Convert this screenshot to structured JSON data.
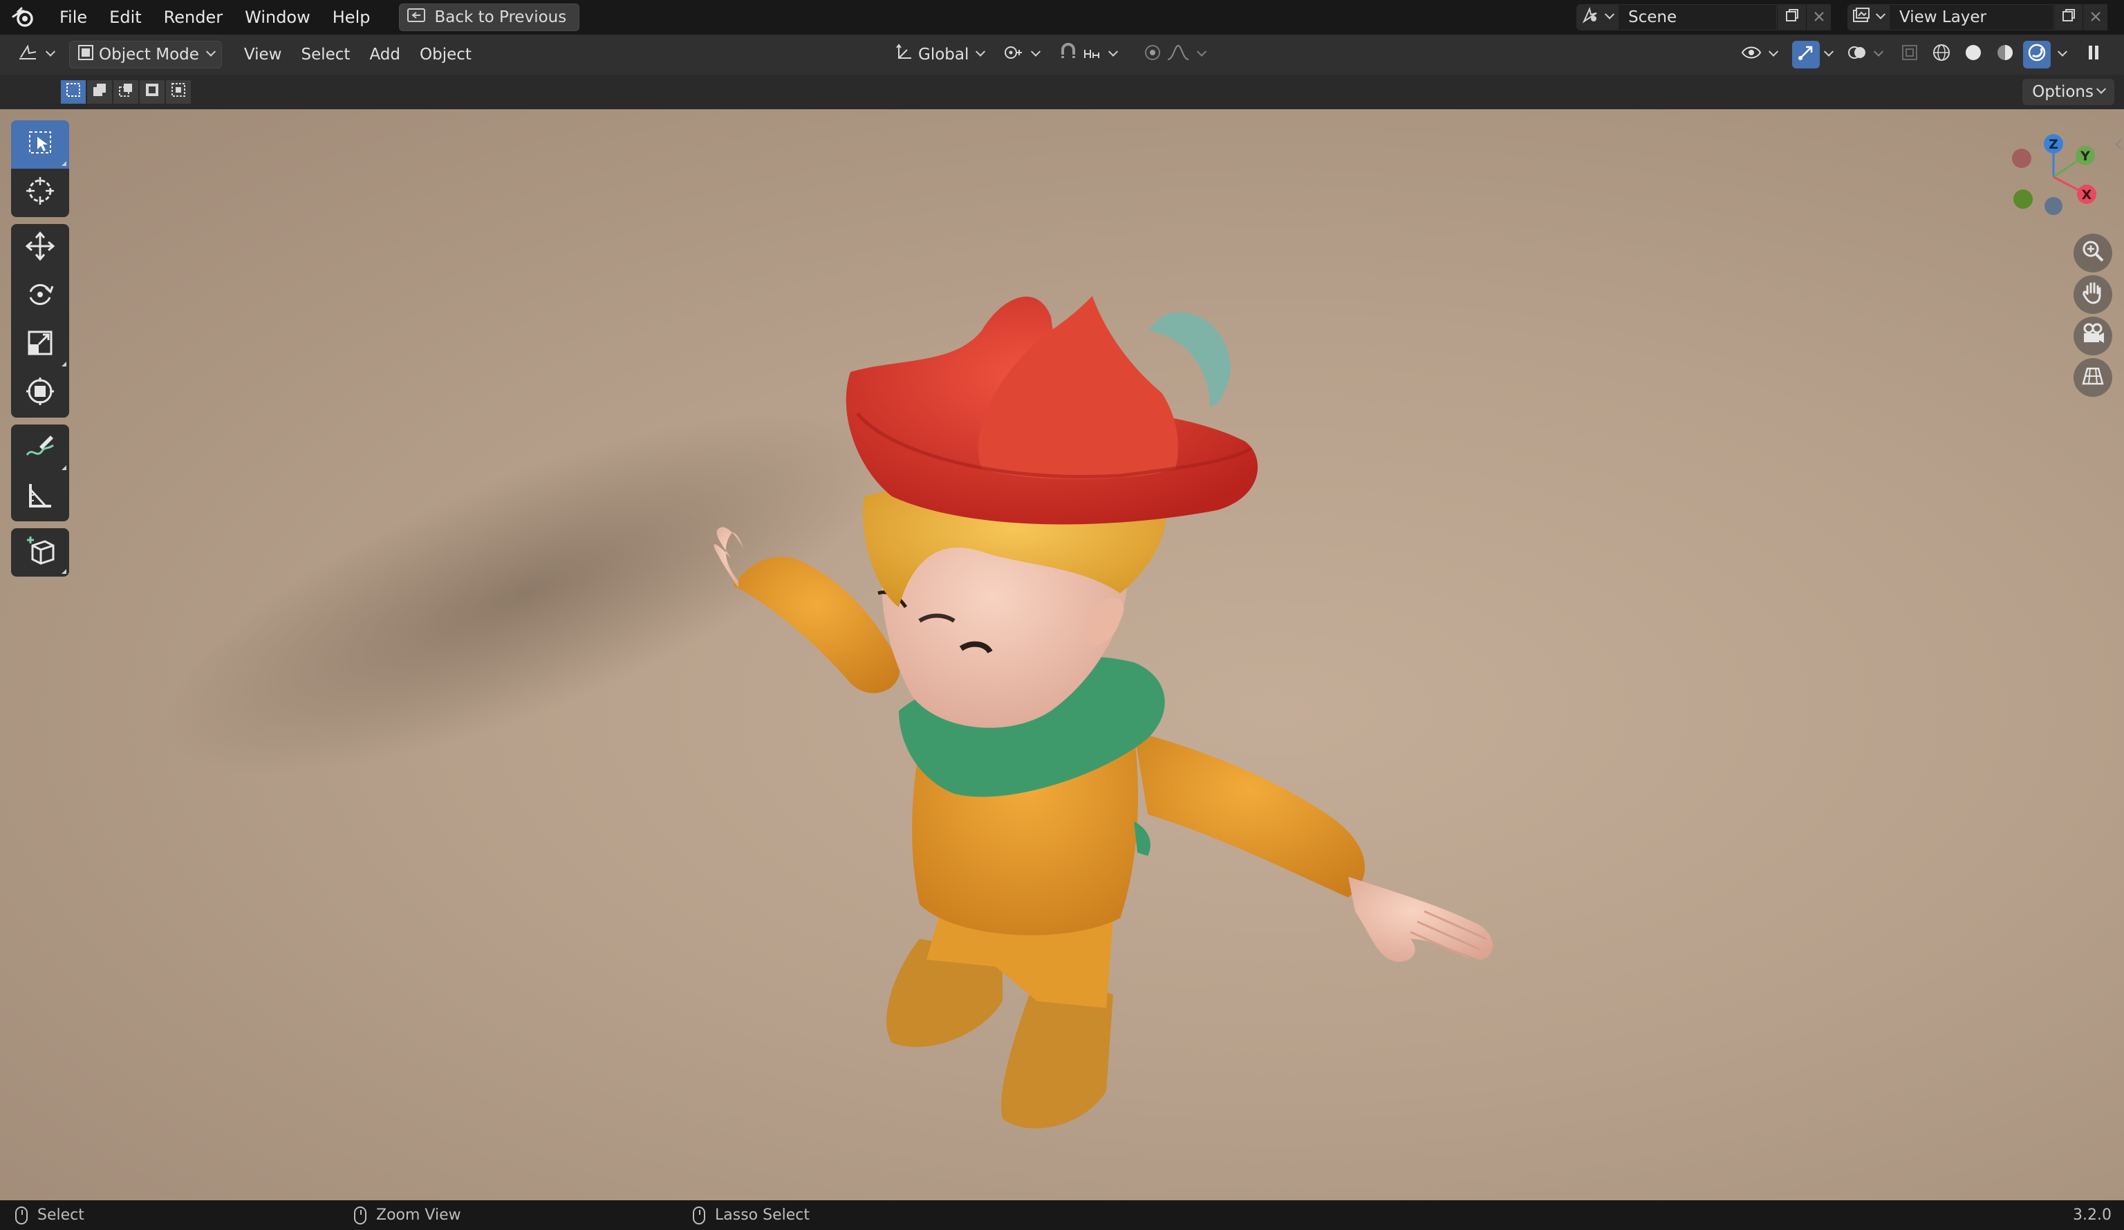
{
  "topbar": {
    "menus": [
      "File",
      "Edit",
      "Render",
      "Window",
      "Help"
    ],
    "back_button": "Back to Previous",
    "scene_name": "Scene",
    "view_layer": "View Layer"
  },
  "header": {
    "mode": "Object Mode",
    "menus": [
      "View",
      "Select",
      "Add",
      "Object"
    ],
    "transform_orientation": "Global"
  },
  "subbar": {
    "options_label": "Options"
  },
  "gizmo": {
    "z": "Z",
    "y": "Y",
    "x": "X"
  },
  "statusbar": {
    "left_action": "Select",
    "middle_action": "Zoom View",
    "right_action": "Lasso Select",
    "version": "3.2.0"
  },
  "colors": {
    "accent": "#4772b3",
    "axis_x": "#e84a5f",
    "axis_y": "#6aa84f",
    "axis_z": "#3b82d6",
    "hat": "#d7322a",
    "shirt": "#e69a2a",
    "scarf": "#3f9a6b",
    "hair": "#f0b64a",
    "skin": "#f2c3b0"
  },
  "icons": [
    "blender-logo",
    "back-icon",
    "scene-icon",
    "copy-icon",
    "close-icon",
    "view-layer-icon",
    "editor-type-icon",
    "object-mode-icon",
    "transform-icon",
    "pivot-icon",
    "snap-icon",
    "proportional-icon",
    "visibility-icon",
    "gizmo-icon",
    "overlay-icon",
    "xray-icon",
    "wireframe-shading-icon",
    "solid-shading-icon",
    "material-shading-icon",
    "rendered-shading-icon",
    "select-box-tool-icon",
    "cursor-tool-icon",
    "move-tool-icon",
    "rotate-tool-icon",
    "scale-tool-icon",
    "transform-tool-icon",
    "annotate-tool-icon",
    "measure-tool-icon",
    "add-cube-tool-icon",
    "zoom-icon",
    "hand-pan-icon",
    "camera-icon",
    "ortho-grid-icon"
  ]
}
